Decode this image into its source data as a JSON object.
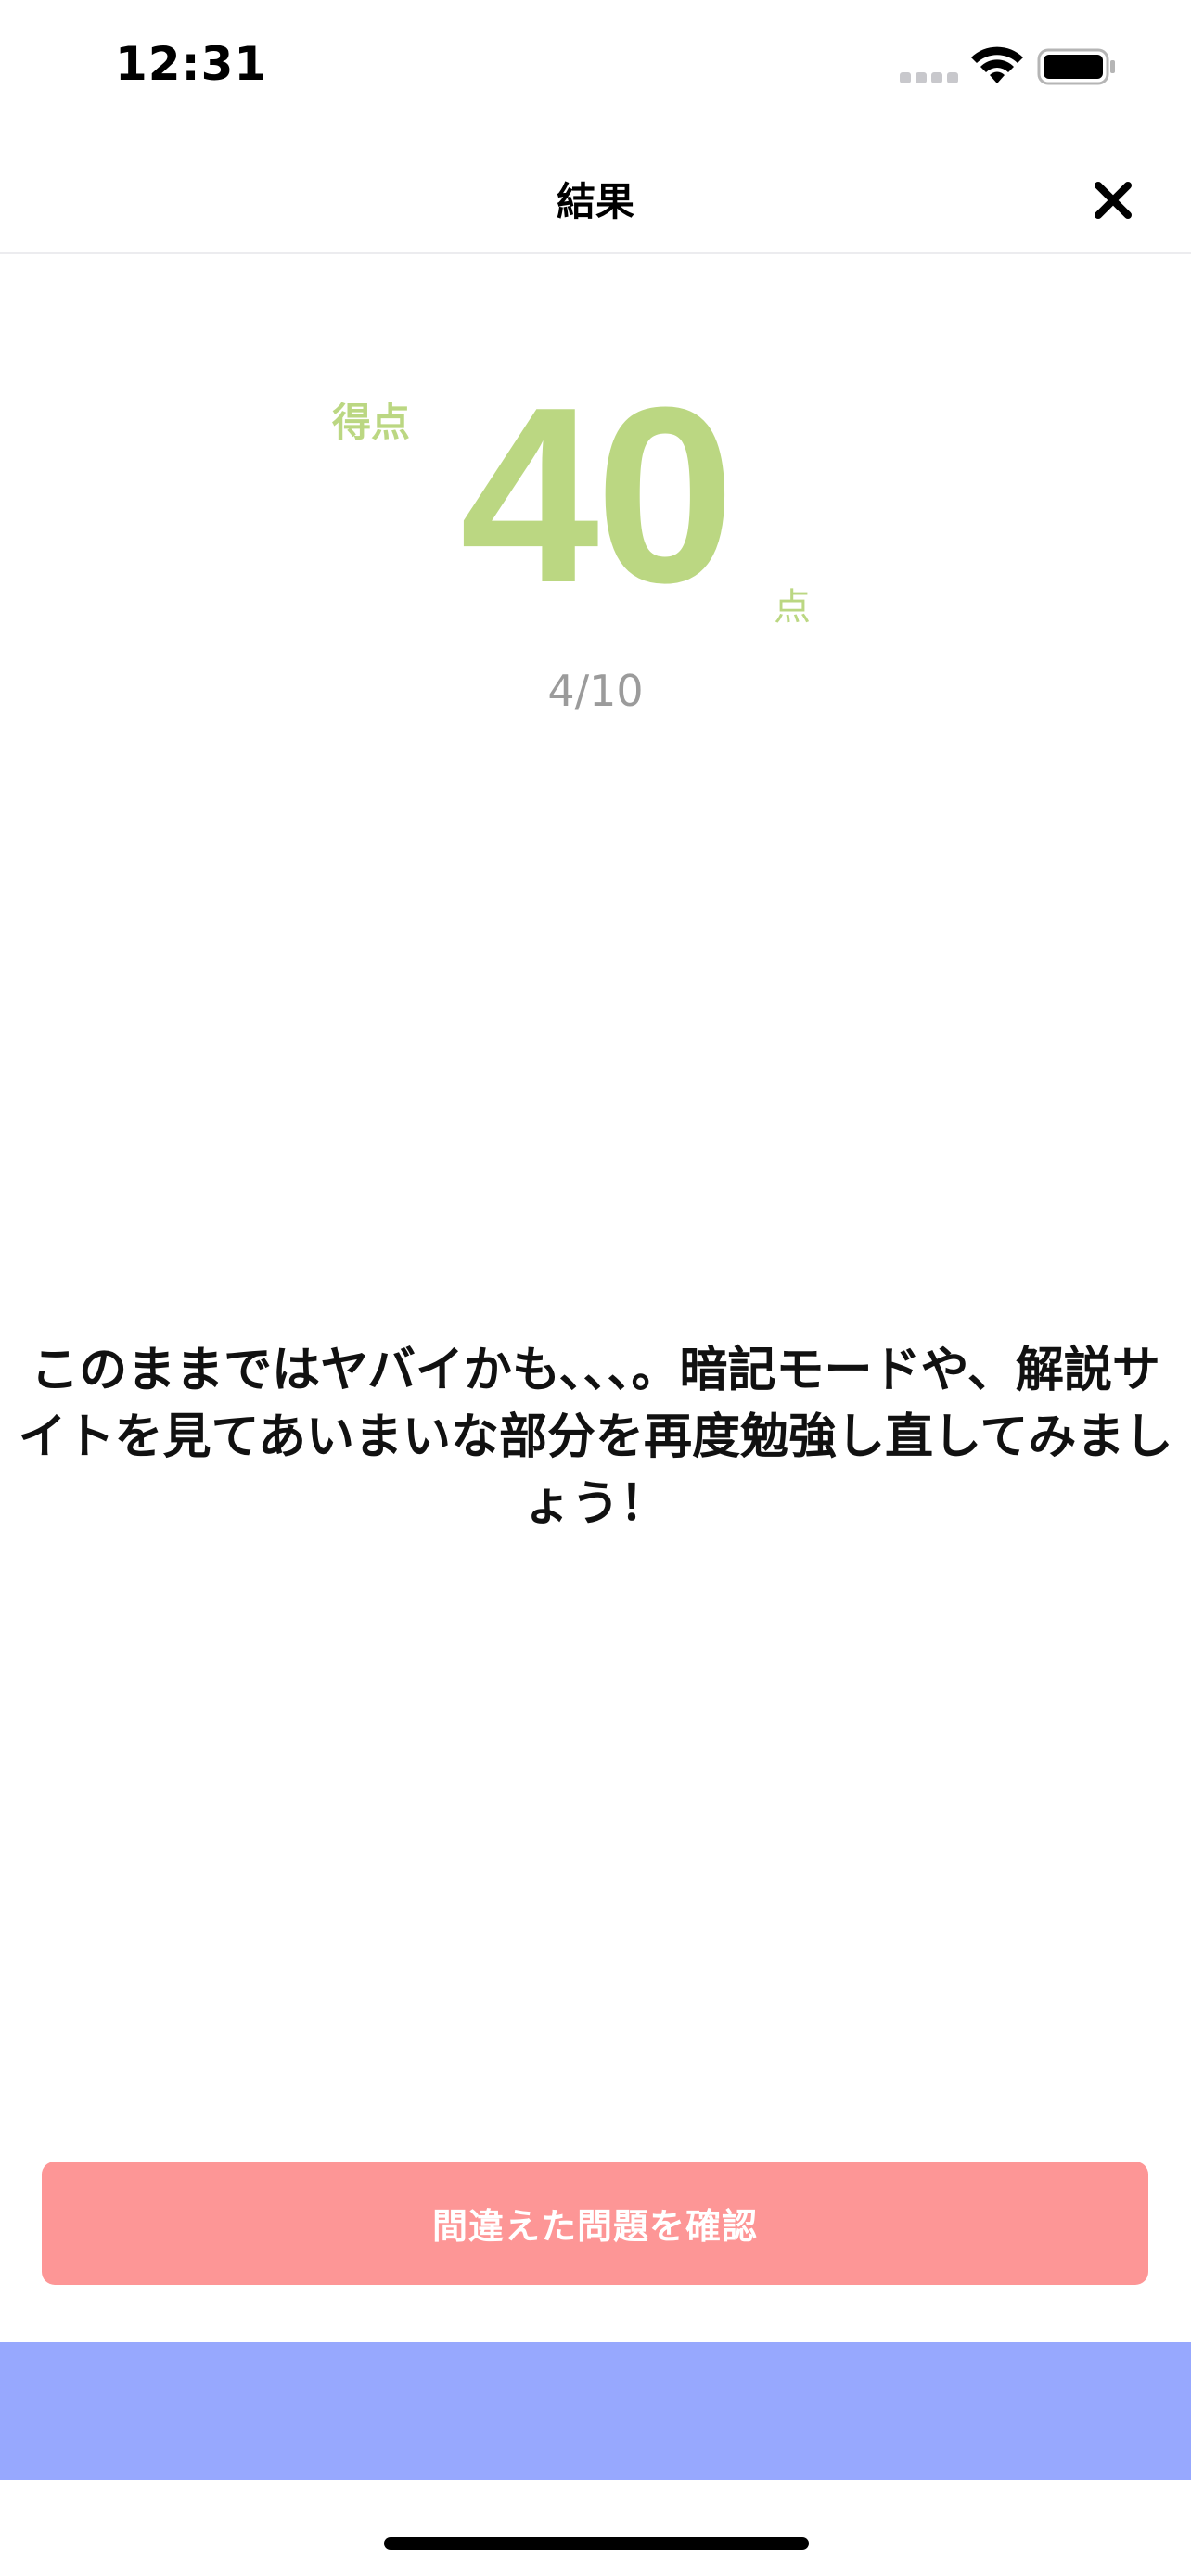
{
  "status_bar": {
    "time": "12:31"
  },
  "nav": {
    "title": "結果"
  },
  "score": {
    "label": "得点",
    "value": "40",
    "unit": "点",
    "fraction": "4/10"
  },
  "message": "このままではヤバイかも、、、。暗記モードや、解説サイトを見てあいまいな部分を再度勉強し直してみましょう！",
  "review_button": {
    "label": "間違えた問題を確認"
  },
  "colors": {
    "score_accent": "#bbd782",
    "button": "#fd9696",
    "bottom_panel": "#97a8fe"
  }
}
